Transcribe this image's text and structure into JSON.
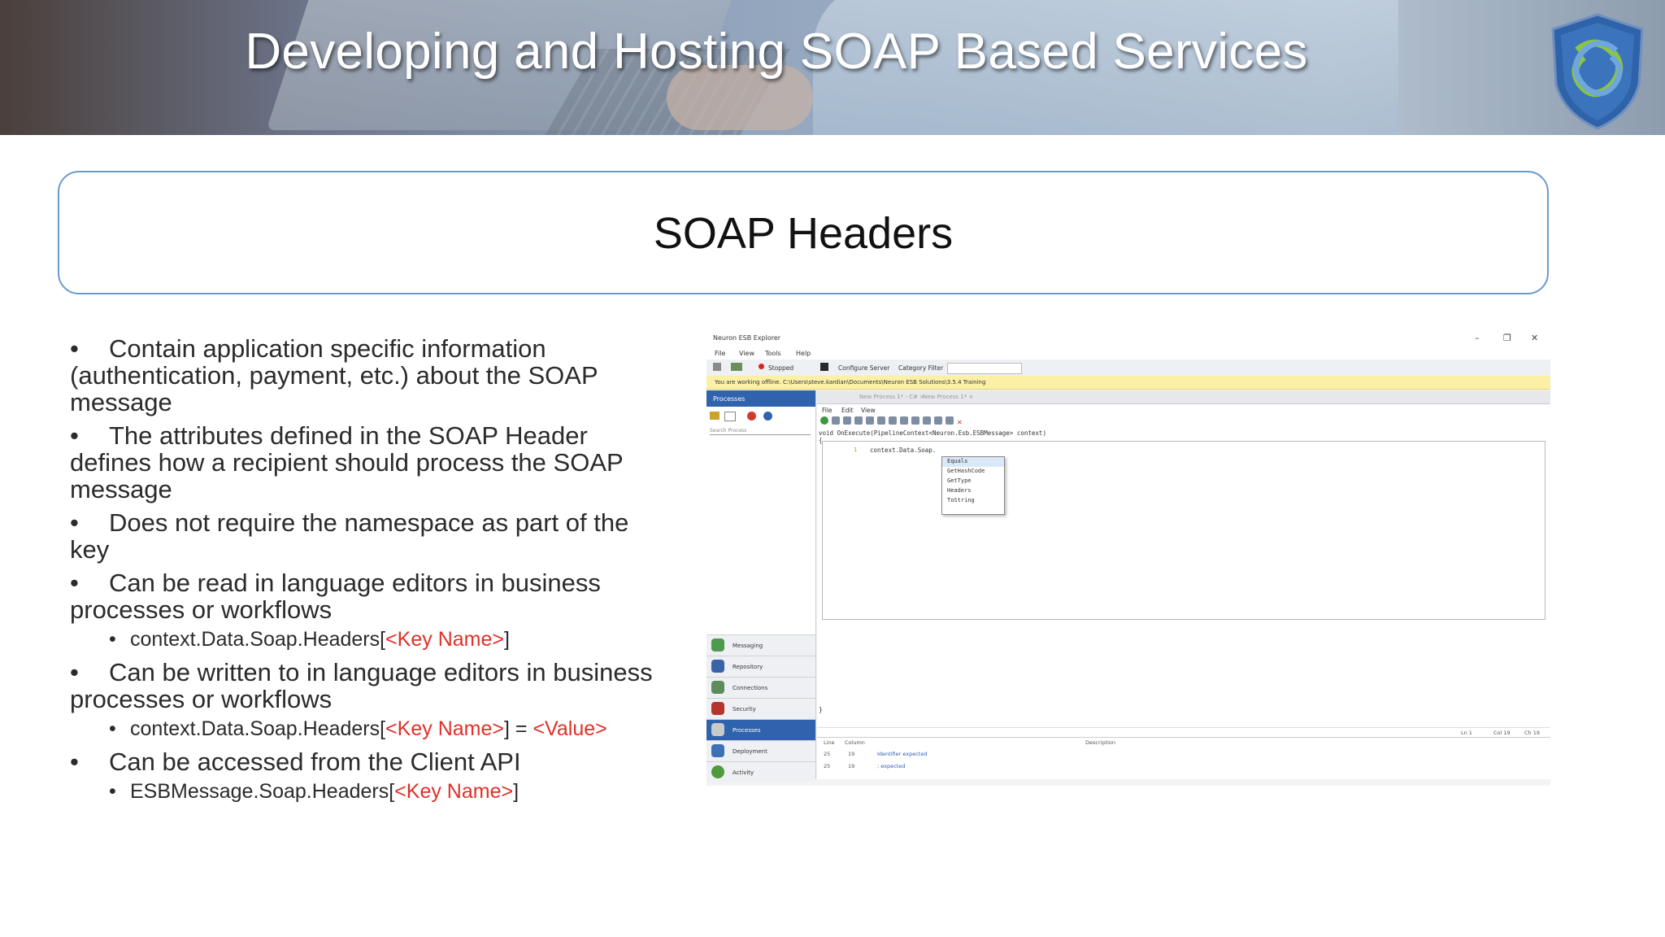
{
  "banner": {
    "title": "Developing and Hosting SOAP Based Services"
  },
  "heading": {
    "title": "SOAP Headers"
  },
  "bullets": {
    "items": [
      {
        "text": "Contain application specific information (authentication, payment, etc.) about the SOAP message"
      },
      {
        "text": "The attributes defined in the SOAP Header defines how a recipient should process the SOAP message"
      },
      {
        "text": "Does not require the namespace as part of the key"
      },
      {
        "text": "Can be read in language editors in business processes or workflows"
      },
      {
        "text": "Can be written to in language editors in business processes or workflows"
      },
      {
        "text": "Can be accessed from the Client API"
      }
    ],
    "sub1": {
      "prefix": "context.Data.Soap.Headers[",
      "key": "<Key Name>",
      "suffix": "]"
    },
    "sub2": {
      "prefix": "context.Data.Soap.Headers[",
      "key": "<Key Name>",
      "mid": "] = ",
      "value": "<Value>"
    },
    "sub3": {
      "prefix": "ESBMessage.Soap.Headers[",
      "key": "<Key Name>",
      "suffix": "]"
    }
  },
  "screenshot": {
    "window_title": "Neuron ESB Explorer",
    "menu": [
      "File",
      "View",
      "Tools",
      "Help"
    ],
    "toolbar": {
      "status": "Stopped",
      "configure_server": "Configure Server",
      "category_filter": "Category Filter"
    },
    "offline_notice": "You are working offline. C:\\Users\\steve.kardian\\Documents\\Neuron ESB Solutions\\3.5.4 Training",
    "left_panel": {
      "header": "Processes",
      "search_placeholder": "Search Process",
      "nav": [
        "Messaging",
        "Repository",
        "Connections",
        "Security",
        "Processes",
        "Deployment",
        "Activity"
      ],
      "active_nav": "Processes"
    },
    "editor": {
      "tabs": [
        "New Process 1* - C# ×",
        "New Process 1* ×"
      ],
      "menu": [
        "File",
        "Edit",
        "View"
      ],
      "signature": "void OnExecute(PipelineContext<Neuron.Esb.ESBMessage> context)",
      "open_brace": "{",
      "line_number": "1",
      "code_line": "context.Data.Soap.",
      "close_brace": "}",
      "autocomplete": [
        "Equals",
        "GetHashCode",
        "GetType",
        "Headers",
        "ToString"
      ],
      "status": {
        "ln": "Ln 1",
        "col": "Col 19",
        "ch": "Ch 19"
      },
      "errors": {
        "headers": [
          "Line",
          "Column",
          "Description"
        ],
        "rows": [
          {
            "line": "25",
            "column": "19",
            "description": "Identifier expected"
          },
          {
            "line": "25",
            "column": "19",
            "description": "; expected"
          }
        ]
      }
    }
  }
}
